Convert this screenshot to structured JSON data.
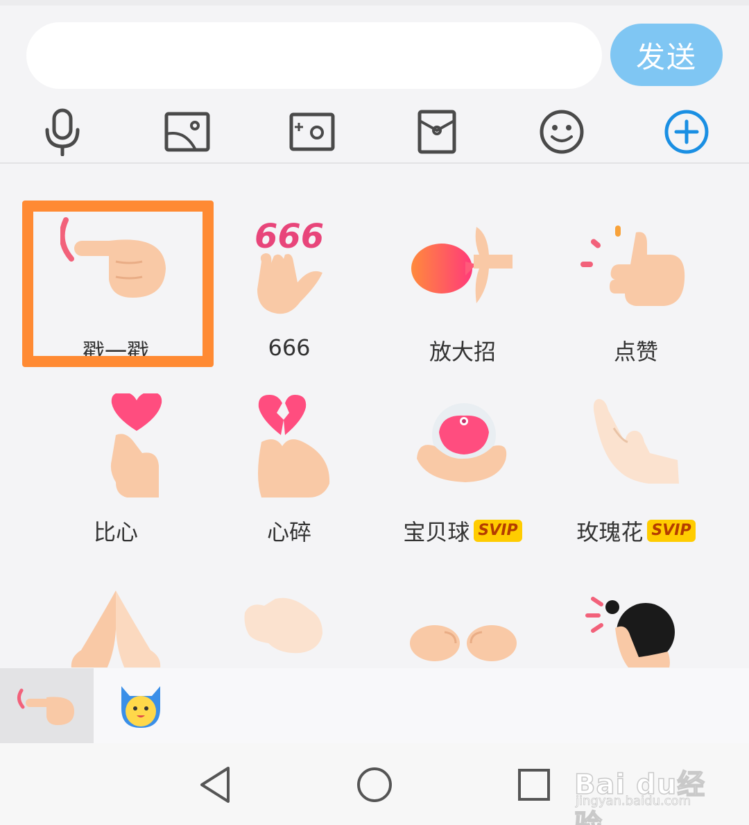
{
  "composer": {
    "input_value": "",
    "send_label": "发送"
  },
  "toolbar": {
    "icons": [
      "microphone-icon",
      "image-icon",
      "camera-icon",
      "red-packet-icon",
      "emoji-icon",
      "plus-icon"
    ],
    "accent": "#1a8fe3"
  },
  "stickers": [
    {
      "label": "戳一戳",
      "badge": "",
      "selected": true,
      "icon": "poke-hand-icon"
    },
    {
      "label": "666",
      "badge": "",
      "icon": "six-six-six-hand-icon"
    },
    {
      "label": "放大招",
      "badge": "",
      "icon": "fireball-hands-icon"
    },
    {
      "label": "点赞",
      "badge": "",
      "icon": "thumbs-up-icon"
    },
    {
      "label": "比心",
      "badge": "",
      "icon": "finger-heart-icon"
    },
    {
      "label": "心碎",
      "badge": "",
      "icon": "broken-heart-icon"
    },
    {
      "label": "宝贝球",
      "badge": "SVIP",
      "icon": "baby-ball-icon"
    },
    {
      "label": "玫瑰花",
      "badge": "SVIP",
      "icon": "rose-hand-icon"
    },
    {
      "label": "",
      "badge": "",
      "icon": "praying-hands-icon"
    },
    {
      "label": "",
      "badge": "",
      "icon": "pinching-hand-icon"
    },
    {
      "label": "",
      "badge": "",
      "icon": "cupped-hands-icon"
    },
    {
      "label": "",
      "badge": "",
      "icon": "head-pat-icon"
    }
  ],
  "packs": [
    {
      "icon": "poke-hand-pack-icon",
      "active": true
    },
    {
      "icon": "devil-cat-pack-icon",
      "active": false
    }
  ],
  "navigation": {
    "icons": [
      "back-icon",
      "home-icon",
      "recents-icon"
    ]
  },
  "watermark": {
    "brand": "Bai du经验",
    "url": "jingyan.baidu.com"
  },
  "colors": {
    "highlight": "#ff8a33",
    "send_button": "#7fc6f3",
    "svip_badge": "#ffcc00"
  }
}
